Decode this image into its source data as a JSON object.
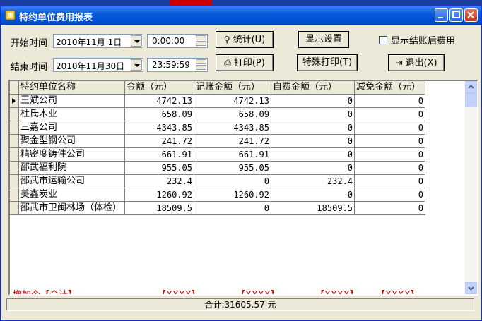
{
  "window": {
    "title": "特约单位费用报表"
  },
  "filters": {
    "start_label": "开始时间",
    "start_date": "2010年11月 1日",
    "start_time": "0:00:00",
    "end_label": "结束时间",
    "end_date": "2010年11月30日",
    "end_time": "23:59:59"
  },
  "buttons": {
    "stats": "统计(U)",
    "display_settings": "显示设置",
    "print": "打印(P)",
    "special_print": "特殊打印(T)",
    "exit": "退出(X)"
  },
  "checkbox": {
    "label": "显示结账后费用",
    "checked": false
  },
  "table": {
    "columns": [
      "特约单位名称",
      "金额（元）",
      "记账金额（元）",
      "自费金额（元）",
      "减免金额（元）"
    ],
    "rows": [
      [
        "王斌公司",
        "4742.13",
        "4742.13",
        "0",
        "0"
      ],
      [
        "杜氏木业",
        "658.09",
        "658.09",
        "0",
        "0"
      ],
      [
        "三嘉公司",
        "4343.85",
        "4343.85",
        "0",
        "0"
      ],
      [
        "聚金型钢公司",
        "241.72",
        "241.72",
        "0",
        "0"
      ],
      [
        "精密度铸件公司",
        "661.91",
        "661.91",
        "0",
        "0"
      ],
      [
        "邵武福利院",
        "955.05",
        "955.05",
        "0",
        "0"
      ],
      [
        "邵武市运输公司",
        "232.4",
        "0",
        "232.4",
        "0"
      ],
      [
        "美鑫炭业",
        "1260.92",
        "1260.92",
        "0",
        "0"
      ],
      [
        "邵武市卫闽林场（体检）",
        "18509.5",
        "0",
        "18509.5",
        "0"
      ]
    ],
    "footer": [
      "增加个【合计】",
      "【XXXX】",
      "【XXXX】",
      "【XXXX】",
      "【XXXX】"
    ]
  },
  "status": {
    "total": "合计:31605.57 元"
  }
}
